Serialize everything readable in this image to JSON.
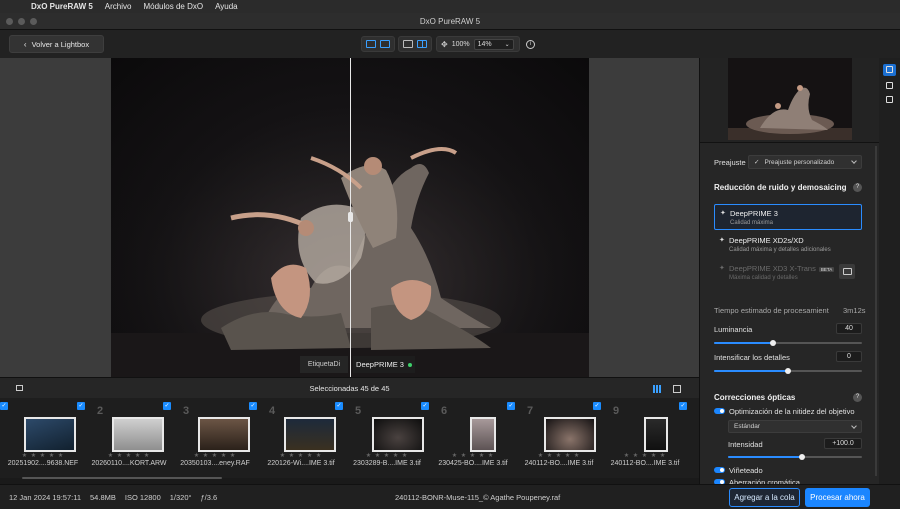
{
  "menubar": {
    "app_name": "DxO PureRAW 5",
    "items": [
      "Archivo",
      "Módulos de DxO",
      "Ayuda"
    ]
  },
  "window": {
    "title": "DxO PureRAW 5"
  },
  "toolbar": {
    "back_label": "Volver a Lightbox",
    "zoom_fit": "100%",
    "zoom_value": "14%"
  },
  "viewer": {
    "left_label": "EtiquetaDi",
    "right_label": "DeepPRIME 3"
  },
  "filmstrip": {
    "selection_text": "Seleccionadas 45 de 45",
    "stars": "★ ★ ★ ★ ★",
    "items": [
      {
        "num": "",
        "name": "20251902....9638.NEF"
      },
      {
        "num": "2",
        "name": "20260110....KORT.ARW"
      },
      {
        "num": "3",
        "name": "20350103....eney.RAF"
      },
      {
        "num": "4",
        "name": "220126-Wi....IME 3.tif"
      },
      {
        "num": "5",
        "name": "2303289-B....IME 3.tif"
      },
      {
        "num": "6",
        "name": "230425-BO....IME 3.tif"
      },
      {
        "num": "7",
        "name": "240112-BO....IME 3.tif"
      },
      {
        "num": "8",
        "name": "240112-BO....IME 3.tif"
      }
    ],
    "trailing_num": "9"
  },
  "status": {
    "date": "12 Jan 2024 19:57:11",
    "size": "54.8MB",
    "iso": "ISO 12800",
    "shutter": "1/320°",
    "aperture": "ƒ/3.6",
    "filename": "240112-BONR-Muse-115_© Agathe Poupeney.raf",
    "queue_button": "Agregar a la cola",
    "process_button": "Procesar ahora"
  },
  "panel": {
    "preset_label": "Preajuste",
    "preset_value": "Preajuste personalizado",
    "noise_heading": "Reducción de ruido y demosaicing",
    "options": [
      {
        "title": "DeepPRIME 3",
        "subtitle": "Calidad máxima"
      },
      {
        "title": "DeepPRIME XD2s/XD",
        "subtitle": "Calidad máxima y detalles adicionales"
      },
      {
        "title": "DeepPRIME XD3 X-Trans",
        "subtitle": "Máxima calidad y detalles",
        "badge": "BETA"
      }
    ],
    "time_label": "Tiempo estimado de procesamient",
    "time_value": "3m12s",
    "luminance_label": "Luminancia",
    "luminance_value": "40",
    "luminance_level": 40,
    "details_label": "Intensificar los detalles",
    "details_value": "0",
    "details_level": 50,
    "optical_heading": "Correcciones ópticas",
    "sharpness_label": "Optimización de la nitidez del objetivo",
    "sharpness_mode": "Estándar",
    "intensity_label": "Intensidad",
    "intensity_value": "+100.0",
    "intensity_level": 55,
    "vignetting_label": "Viñeteado",
    "chromatic_label": "Aberración cromática"
  }
}
